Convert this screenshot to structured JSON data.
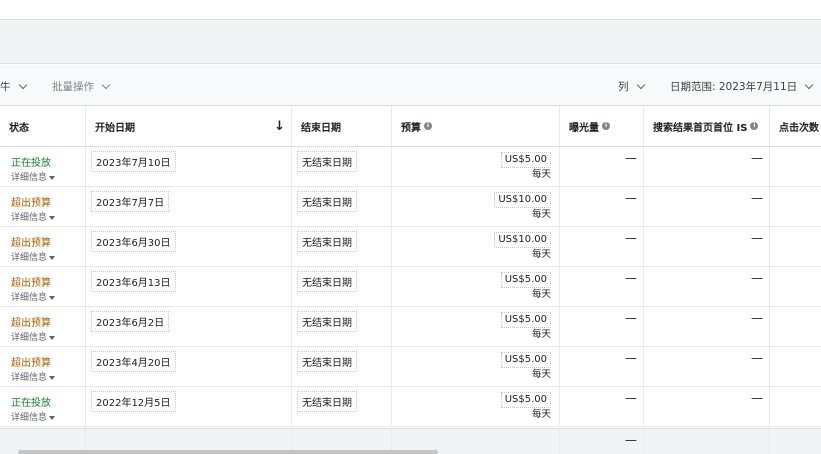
{
  "toolbar": {
    "filter_partial": "牛",
    "bulk_ops": "批量操作",
    "columns": "列",
    "date_range": "日期范围: 2023年7月11日"
  },
  "columns": {
    "status": "状态",
    "start_date": "开始日期",
    "end_date": "结束日期",
    "budget": "预算",
    "impressions": "曝光量",
    "search_top_is": "搜索结果首页首位 IS",
    "clicks": "点击次数"
  },
  "sort_arrow": "↓",
  "details_label": "详细信息",
  "rows": [
    {
      "status": "正在投放",
      "status_type": "green",
      "start": "2023年7月10日",
      "end": "无结束日期",
      "budget": "US$5.00",
      "per": "每天",
      "impressions": "—",
      "top_is": "—"
    },
    {
      "status": "超出预算",
      "status_type": "orange",
      "start": "2023年7月7日",
      "end": "无结束日期",
      "budget": "US$10.00",
      "per": "每天",
      "impressions": "—",
      "top_is": "—"
    },
    {
      "status": "超出预算",
      "status_type": "orange",
      "start": "2023年6月30日",
      "end": "无结束日期",
      "budget": "US$10.00",
      "per": "每天",
      "impressions": "—",
      "top_is": "—"
    },
    {
      "status": "超出预算",
      "status_type": "orange",
      "start": "2023年6月13日",
      "end": "无结束日期",
      "budget": "US$5.00",
      "per": "每天",
      "impressions": "—",
      "top_is": "—"
    },
    {
      "status": "超出预算",
      "status_type": "orange",
      "start": "2023年6月2日",
      "end": "无结束日期",
      "budget": "US$5.00",
      "per": "每天",
      "impressions": "—",
      "top_is": "—"
    },
    {
      "status": "超出预算",
      "status_type": "orange",
      "start": "2023年4月20日",
      "end": "无结束日期",
      "budget": "US$5.00",
      "per": "每天",
      "impressions": "—",
      "top_is": "—"
    },
    {
      "status": "正在投放",
      "status_type": "green",
      "start": "2022年12月5日",
      "end": "无结束日期",
      "budget": "US$5.00",
      "per": "每天",
      "impressions": "—",
      "top_is": "—"
    }
  ],
  "footer": {
    "impressions_total": "—"
  },
  "colors": {
    "status_green": "#188038",
    "status_orange": "#b06000"
  }
}
